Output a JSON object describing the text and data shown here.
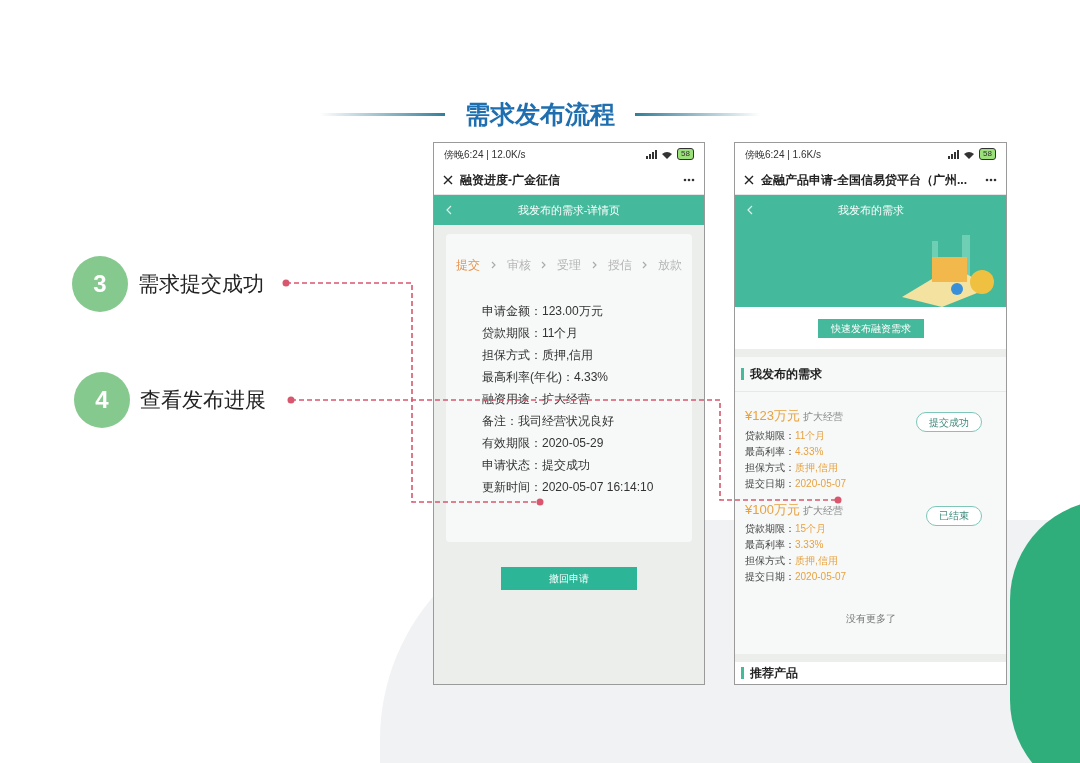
{
  "title": "需求发布流程",
  "steps": [
    {
      "number": "3",
      "label": "需求提交成功"
    },
    {
      "number": "4",
      "label": "查看发布进展"
    }
  ],
  "detail_phone": {
    "status_text": "傍晚6:24 | 12.0K/s",
    "battery": "58",
    "app_title": "融资进度-广金征信",
    "header_title": "我发布的需求-详情页",
    "progress": [
      {
        "label": "提交",
        "selected": true
      },
      {
        "label": "审核",
        "selected": false
      },
      {
        "label": "受理",
        "selected": false
      },
      {
        "label": "授信",
        "selected": false
      },
      {
        "label": "放款",
        "selected": false
      }
    ],
    "fields": [
      "申请金额：123.00万元",
      "贷款期限：11个月",
      "担保方式：质押,信用",
      "最高利率(年化)：4.33%",
      "融资用途：扩大经营",
      "备注：我司经营状况良好",
      "有效期限：2020-05-29",
      "申请状态：提交成功",
      "更新时间：2020-05-07 16:14:10"
    ],
    "button": "撤回申请"
  },
  "list_phone": {
    "status_text": "傍晚6:24 | 1.6K/s",
    "battery": "58",
    "app_title": "金融产品申请-全国信易贷平台（广州...",
    "header_title": "我发布的需求",
    "button": "快速发布融资需求",
    "section_title": "我发布的需求",
    "items": [
      {
        "amount": "¥123万元",
        "purpose": "扩大经营",
        "status": "提交成功",
        "fields": [
          {
            "label": "贷款期限：",
            "value": "11个月"
          },
          {
            "label": "最高利率：",
            "value": "4.33%"
          },
          {
            "label": "担保方式：",
            "value": "质押,信用"
          },
          {
            "label": "提交日期：",
            "value": "2020-05-07"
          }
        ]
      },
      {
        "amount": "¥100万元",
        "purpose": "扩大经营",
        "status": "已结束",
        "fields": [
          {
            "label": "贷款期限：",
            "value": "15个月"
          },
          {
            "label": "最高利率：",
            "value": "3.33%"
          },
          {
            "label": "担保方式：",
            "value": "质押,信用"
          },
          {
            "label": "提交日期：",
            "value": "2020-05-07"
          }
        ]
      }
    ],
    "end_text": "没有更多了",
    "next_section": "推荐产品"
  }
}
